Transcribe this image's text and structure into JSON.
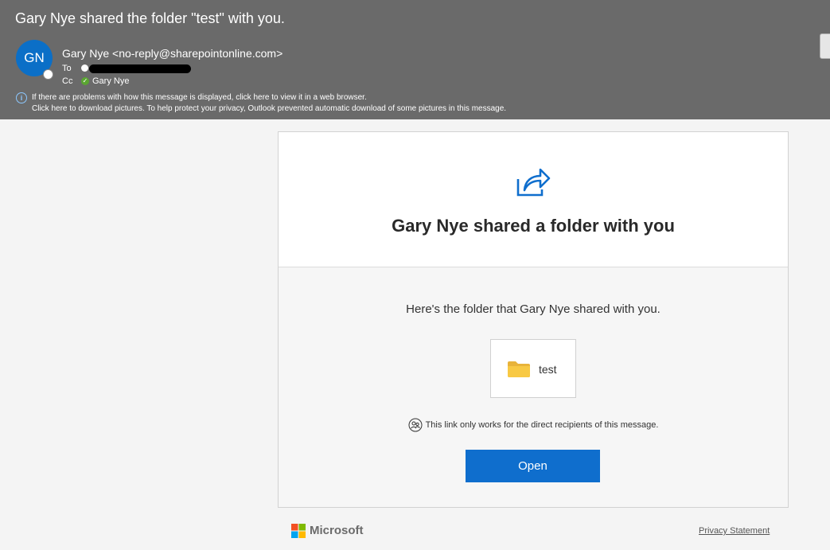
{
  "email": {
    "subject": "Gary Nye shared the folder \"test\" with you.",
    "avatar_initials": "GN",
    "sender": "Gary Nye <no-reply@sharepointonline.com>",
    "to_label": "To",
    "cc_label": "Cc",
    "cc_name": "Gary Nye",
    "info_line_1": "If there are problems with how this message is displayed, click here to view it in a web browser.",
    "info_line_2": "Click here to download pictures. To help protect your privacy, Outlook prevented automatic download of some pictures in this message."
  },
  "card": {
    "title": "Gary Nye shared a folder with you",
    "body_text": "Here's the folder that Gary Nye shared with you.",
    "file_name": "test",
    "link_note": "This link only works for the direct recipients of this message.",
    "open_button": "Open"
  },
  "footer": {
    "brand": "Microsoft",
    "privacy": "Privacy Statement"
  },
  "icons": {
    "share": "share-arrow-icon",
    "folder": "folder-icon",
    "people": "people-icon",
    "info": "info-icon"
  },
  "colors": {
    "header_bg": "#6a6a6a",
    "avatar": "#0b6fc7",
    "button": "#0f6ecd",
    "folder": "#f8c944"
  }
}
